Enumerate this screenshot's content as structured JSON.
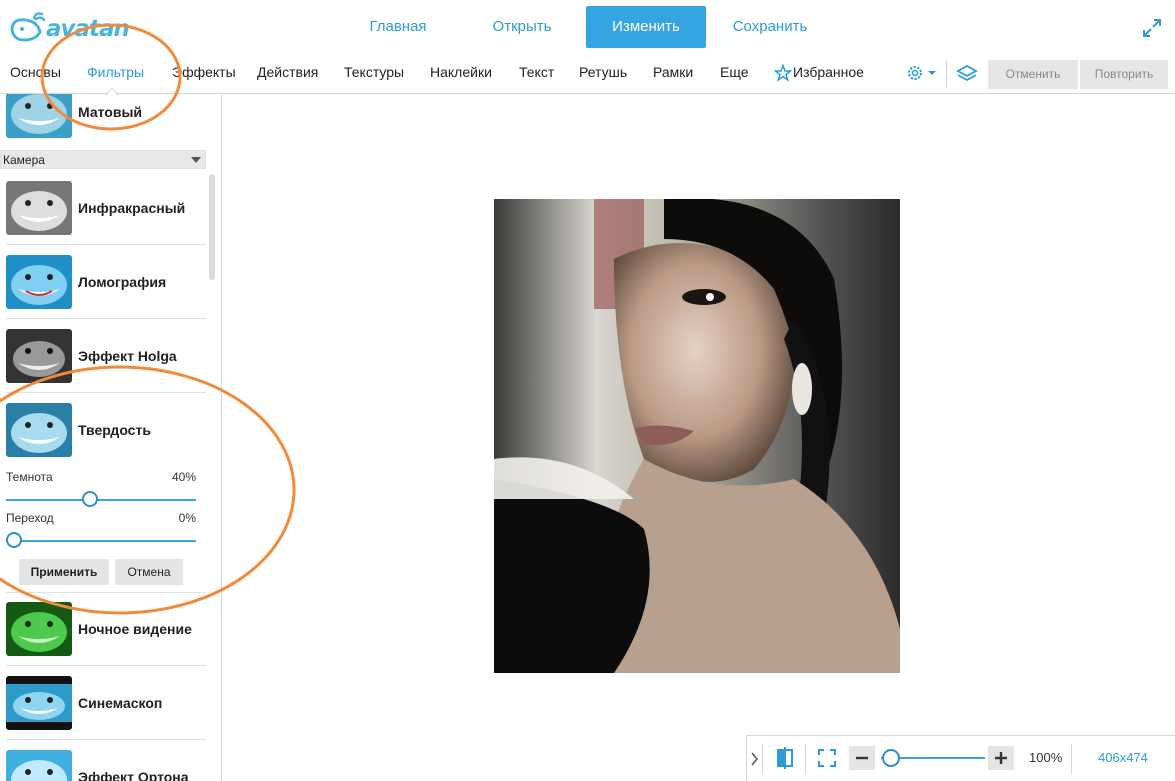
{
  "app": {
    "logo_text": "avatan",
    "accent_color": "#36a3e2"
  },
  "topnav": {
    "items": [
      {
        "label": "Главная",
        "active": false
      },
      {
        "label": "Открыть",
        "active": false
      },
      {
        "label": "Изменить",
        "active": true
      },
      {
        "label": "Сохранить",
        "active": false
      }
    ],
    "expand_icon": "expand-arrows-icon"
  },
  "tabs": {
    "items": [
      "Основы",
      "Фильтры",
      "Эффекты",
      "Действия",
      "Текстуры",
      "Наклейки",
      "Текст",
      "Ретушь",
      "Рамки",
      "Еще",
      "Избранное"
    ],
    "active": "Фильтры",
    "undo_label": "Отменить",
    "redo_label": "Повторить"
  },
  "sidebar": {
    "top_item": "Матовый",
    "category": "Камера",
    "items": [
      {
        "label": "Инфракрасный",
        "style": "gray"
      },
      {
        "label": "Ломография",
        "style": "blue"
      },
      {
        "label": "Эффект Holga",
        "style": "gray"
      },
      {
        "label": "Твердость",
        "style": "blue"
      },
      {
        "label": "Ночное видение",
        "style": "green"
      },
      {
        "label": "Синемаскоп",
        "style": "blue"
      },
      {
        "label": "Эффект Ортона",
        "style": "blue"
      }
    ],
    "controls": {
      "darkness_label": "Темнота",
      "darkness_value": "40%",
      "darkness_level": 0.4,
      "transition_label": "Переход",
      "transition_value": "0%",
      "transition_level": 0.0,
      "apply_label": "Применить",
      "cancel_label": "Отмена"
    }
  },
  "zoombar": {
    "zoom": "100%",
    "dimensions": "406x474",
    "zoom_level": 0.1
  },
  "annotation_color": "#f08a3c"
}
